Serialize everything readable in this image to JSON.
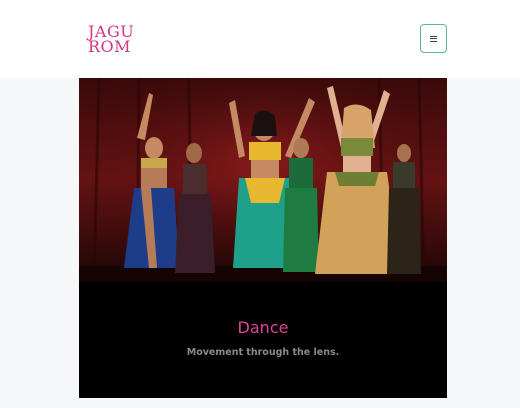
{
  "header": {
    "logo_line1": "JAGU",
    "logo_line2": "ROM",
    "menu_icon": "hamburger-icon"
  },
  "card": {
    "image_subject": "belly dancers performing on a stage with a red curtain",
    "title": "Dance",
    "subtitle": "Movement through the lens."
  },
  "colors": {
    "accent": "#d63384",
    "menu_border": "#5fb3a8"
  }
}
